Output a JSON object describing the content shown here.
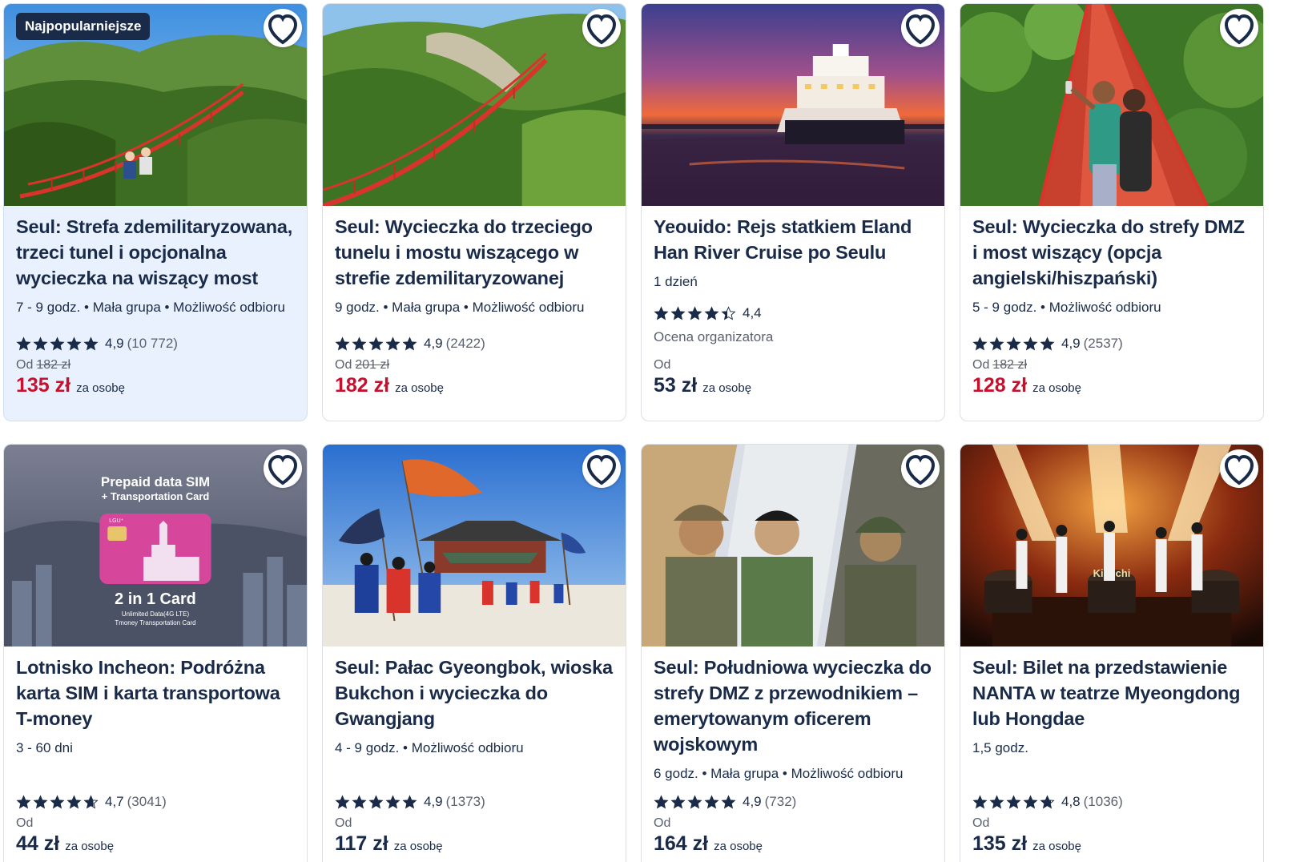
{
  "colors": {
    "sale_price": "#c8102e",
    "text": "#1a2b49",
    "highlight_bg": "#e8f1fd",
    "badge_bg": "#1a2b49"
  },
  "cards": [
    {
      "badge": "Najpopularniejsze",
      "title": "Seul: Strefa zdemilitaryzowana, trzeci tunel i opcjonalna wycieczka na wiszący most",
      "meta": "7 - 9 godz. • Mała grupa • Możliwość odbioru",
      "rating": "4,9",
      "rating_value": 4.9,
      "reviews": "(10 772)",
      "from": "Od",
      "old_price": "182 zł",
      "price": "135 zł",
      "per": "za osobę",
      "sale": true
    },
    {
      "title": "Seul: Wycieczka do trzeciego tunelu i mostu wiszącego w strefie zdemilitaryzowanej",
      "meta": "9 godz. • Mała grupa • Możliwość odbioru",
      "rating": "4,9",
      "rating_value": 4.9,
      "reviews": "(2422)",
      "from": "Od",
      "old_price": "201 zł",
      "price": "182 zł",
      "per": "za osobę",
      "sale": true
    },
    {
      "title": "Yeouido: Rejs statkiem Eland Han River Cruise po Seulu",
      "meta": "1 dzień",
      "rating": "4,4",
      "rating_value": 4.4,
      "reviews": "",
      "sub": "Ocena organizatora",
      "from": "Od",
      "old_price": "",
      "price": "53 zł",
      "per": "za osobę",
      "sale": false
    },
    {
      "title": "Seul: Wycieczka do strefy DMZ i most wiszący (opcja angielski/hiszpański)",
      "meta": "5 - 9 godz. • Możliwość odbioru",
      "rating": "4,9",
      "rating_value": 4.9,
      "reviews": "(2537)",
      "from": "Od",
      "old_price": "182 zł",
      "price": "128 zł",
      "per": "za osobę",
      "sale": true
    },
    {
      "title": "Lotnisko Incheon: Podróżna karta SIM i karta transportowa T-money",
      "meta": "3 - 60 dni",
      "rating": "4,7",
      "rating_value": 4.7,
      "reviews": "(3041)",
      "from": "Od",
      "old_price": "",
      "price": "44 zł",
      "per": "za osobę",
      "sale": false,
      "image_text": {
        "l1": "Prepaid data SIM",
        "l2": "+ Transportation Card",
        "l3": "2 in 1 Card",
        "l4": "Unlimited Data(4G LTE)",
        "l5": "Tmoney Transportation Card"
      }
    },
    {
      "title": "Seul: Pałac Gyeongbok, wioska Bukchon i wycieczka do Gwangjang",
      "meta": "4 - 9 godz. • Możliwość odbioru",
      "rating": "4,9",
      "rating_value": 4.9,
      "reviews": "(1373)",
      "from": "Od",
      "old_price": "",
      "price": "117 zł",
      "per": "za osobę",
      "sale": false
    },
    {
      "title": "Seul: Południowa wycieczka do strefy DMZ z przewodnikiem – emerytowanym oficerem wojskowym",
      "meta": "6 godz. • Mała grupa • Możliwość odbioru",
      "rating": "4,9",
      "rating_value": 4.9,
      "reviews": "(732)",
      "from": "Od",
      "old_price": "",
      "price": "164 zł",
      "per": "za osobę",
      "sale": false
    },
    {
      "title": "Seul: Bilet na przedstawienie NANTA w teatrze Myeongdong lub Hongdae",
      "meta": "1,5 godz.",
      "rating": "4,8",
      "rating_value": 4.8,
      "reviews": "(1036)",
      "from": "Od",
      "old_price": "",
      "price": "135 zł",
      "per": "za osobę",
      "sale": false,
      "image_text": {
        "drum": "Kim chi"
      }
    }
  ]
}
